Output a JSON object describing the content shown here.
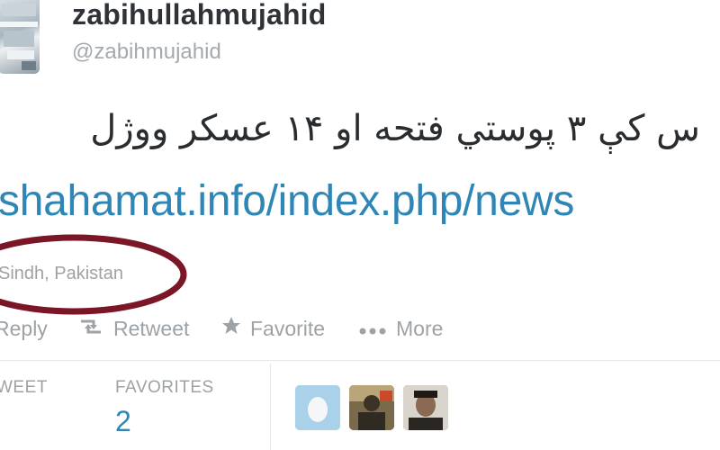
{
  "tweet": {
    "display_name": "zabihullahmujahid",
    "screen_name": "@zabihmujahid",
    "text": "س کې ۳ پوستي فتحه او ۱۴ عسکر ووژل",
    "link": "shahamat.info/index.php/news",
    "location": "Sindh, Pakistan"
  },
  "actions": {
    "reply": "Reply",
    "retweet": "Retweet",
    "favorite": "Favorite",
    "more": "More"
  },
  "stats": {
    "retweets_label": "WEET",
    "favorites_label": "FAVORITES",
    "favorites_count": "2"
  },
  "colors": {
    "link": "#2f86b6",
    "annotation_circle": "#7a1626",
    "muted": "#9da2a6",
    "name": "#2f3337"
  },
  "icons": {
    "retweet": "retweet-icon",
    "favorite": "star-icon",
    "more": "ellipsis-icon"
  }
}
